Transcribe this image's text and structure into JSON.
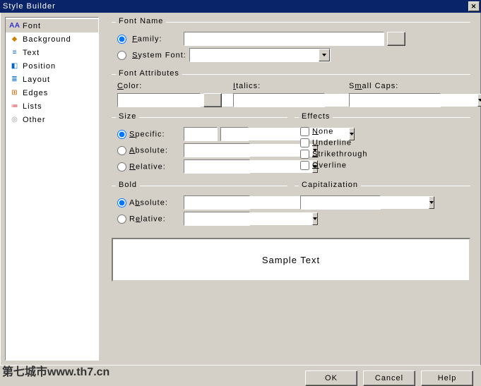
{
  "title": "Style Builder",
  "nav": {
    "items": [
      {
        "label": "Font",
        "icon": "AA",
        "iconColor": "#0000cc"
      },
      {
        "label": "Background",
        "icon": "◆",
        "iconColor": "#d08000"
      },
      {
        "label": "Text",
        "icon": "≡",
        "iconColor": "#0066cc"
      },
      {
        "label": "Position",
        "icon": "◧",
        "iconColor": "#0066cc"
      },
      {
        "label": "Layout",
        "icon": "≣",
        "iconColor": "#0066cc"
      },
      {
        "label": "Edges",
        "icon": "⊞",
        "iconColor": "#cc6600"
      },
      {
        "label": "Lists",
        "icon": "≔",
        "iconColor": "#cc3333"
      },
      {
        "label": "Other",
        "icon": "◎",
        "iconColor": "#999999"
      }
    ],
    "selected": 0
  },
  "fontName": {
    "legend": "Font Name",
    "family": {
      "u": "F",
      "rest": "amily:"
    },
    "system": {
      "u": "S",
      "rest": "ystem Font:"
    },
    "familyValue": "",
    "systemValue": ""
  },
  "fontAttrs": {
    "legend": "Font Attributes",
    "colorLabel": {
      "u": "C",
      "rest": "olor:"
    },
    "italicsLabel": {
      "u": "I",
      "rest": "talics:"
    },
    "smallCapsLabel": {
      "pre": "S",
      "u": "m",
      "rest": "all Caps:"
    },
    "colorValue": "",
    "italicsValue": "",
    "smallCapsValue": ""
  },
  "size": {
    "legend": "Size",
    "specific": {
      "u": "S",
      "rest": "pecific:"
    },
    "absolute": {
      "u": "A",
      "rest": "bsolute:"
    },
    "relative": {
      "u": "R",
      "rest": "elative:"
    },
    "specificValue": "",
    "specificUnit": "",
    "absoluteValue": "",
    "relativeValue": ""
  },
  "effects": {
    "legend": "Effects",
    "none": {
      "u": "N",
      "rest": "one"
    },
    "underline": {
      "u": "U",
      "rest": "nderline"
    },
    "strike": {
      "u": "S",
      "rest": "trikethrough"
    },
    "overline": {
      "u": "O",
      "rest": "verline"
    }
  },
  "bold": {
    "legend": "Bold",
    "absolute": {
      "pre": "A",
      "u": "b",
      "rest": "solute:"
    },
    "relative": {
      "pre": "R",
      "u": "e",
      "rest": "lative:"
    },
    "absoluteValue": "",
    "relativeValue": ""
  },
  "capitalization": {
    "legend": "Capitalization",
    "value": ""
  },
  "sampleText": "Sample Text",
  "buttons": {
    "ok": "OK",
    "cancel": "Cancel",
    "help": "Help"
  },
  "watermark": "第七城市www.th7.cn"
}
